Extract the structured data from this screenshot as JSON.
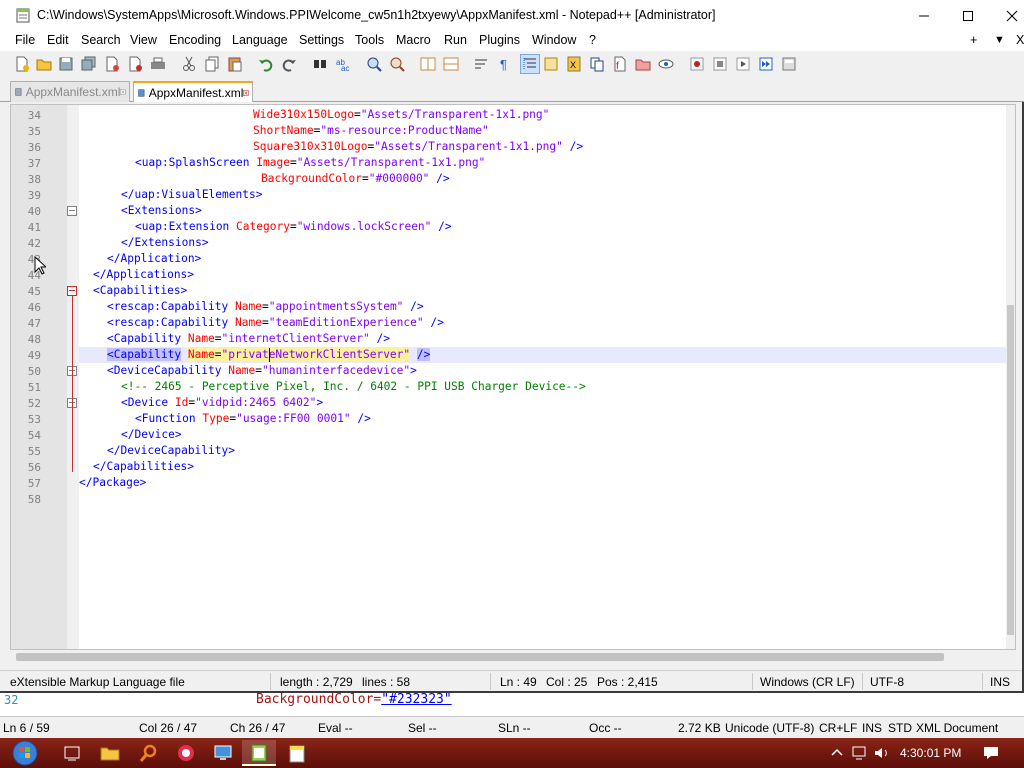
{
  "window": {
    "title": "C:\\Windows\\SystemApps\\Microsoft.Windows.PPIWelcome_cw5n1h2txyewy\\AppxManifest.xml - Notepad++ [Administrator]"
  },
  "menu": {
    "items": [
      "File",
      "Edit",
      "Search",
      "View",
      "Encoding",
      "Language",
      "Settings",
      "Tools",
      "Macro",
      "Run",
      "Plugins",
      "Window",
      "?"
    ],
    "right": [
      "+",
      "▼",
      "X"
    ]
  },
  "tabs": [
    {
      "label": "AppxManifest.xml",
      "active": false
    },
    {
      "label": "AppxManifest.xml",
      "active": true
    }
  ],
  "editor": {
    "current_line": 49,
    "lines": [
      {
        "n": "34",
        "html": "<span class=\"a\">Wide310x150Logo</span><span class=\"b\">=</span><span class=\"v\">\"Assets/Transparent-1x1.png\"</span>"
      },
      {
        "n": "35",
        "html": "<span class=\"a\">ShortName</span><span class=\"b\">=</span><span class=\"v\">\"ms-resource:ProductName\"</span>"
      },
      {
        "n": "36",
        "html": "<span class=\"a\">Square310x310Logo</span><span class=\"b\">=</span><span class=\"v\">\"Assets/Transparent-1x1.png\"</span> <span class=\"t\">/&gt;</span>"
      },
      {
        "n": "37",
        "html": "<span class=\"t\">&lt;uap:SplashScreen</span> <span class=\"a\">Image</span><span class=\"b\">=</span><span class=\"v\">\"Assets/Transparent-1x1.png\"</span>"
      },
      {
        "n": "38",
        "html": "<span class=\"a\">BackgroundColor</span><span class=\"b\">=</span><span class=\"v\">\"#000000\"</span> <span class=\"t\">/&gt;</span>"
      },
      {
        "n": "39",
        "html": "<span class=\"t\">&lt;/uap:VisualElements&gt;</span>"
      },
      {
        "n": "40",
        "html": "<span class=\"t\">&lt;Extensions&gt;</span>"
      },
      {
        "n": "41",
        "html": "<span class=\"t\">&lt;uap:Extension</span> <span class=\"a\">Category</span><span class=\"b\">=</span><span class=\"v\">\"windows.lockScreen\"</span> <span class=\"t\">/&gt;</span>"
      },
      {
        "n": "42",
        "html": "<span class=\"t\">&lt;/Extensions&gt;</span>"
      },
      {
        "n": "43",
        "html": "<span class=\"t\">&lt;/Application&gt;</span>"
      },
      {
        "n": "44",
        "html": "<span class=\"t\">&lt;/Applications&gt;</span>"
      },
      {
        "n": "45",
        "html": "<span class=\"t\">&lt;Capabilities&gt;</span>"
      },
      {
        "n": "46",
        "html": "<span class=\"t\">&lt;rescap:Capability</span> <span class=\"a\">Name</span><span class=\"b\">=</span><span class=\"v\">\"appointmentsSystem\"</span> <span class=\"t\">/&gt;</span>"
      },
      {
        "n": "47",
        "html": "<span class=\"t\">&lt;rescap:Capability</span> <span class=\"a\">Name</span><span class=\"b\">=</span><span class=\"v\">\"teamEditionExperience\"</span> <span class=\"t\">/&gt;</span>"
      },
      {
        "n": "48",
        "html": "<span class=\"t\">&lt;Capability</span> <span class=\"a\">Name</span><span class=\"b\">=</span><span class=\"v\">\"internetClientServer\"</span> <span class=\"t\">/&gt;</span>"
      },
      {
        "n": "49",
        "html": "<span class=\"hl-tag\">&lt;Capability</span> <span class=\"a hl-attr\">Name</span><span class=\"b hl-attr\">=</span><span class=\"v hl-attr\">\"privateNetworkClientServer\"</span> <span class=\"hl-tag\">/&gt;</span>"
      },
      {
        "n": "50",
        "html": "<span class=\"t\">&lt;DeviceCapability</span> <span class=\"a\">Name</span><span class=\"b\">=</span><span class=\"v\">\"humaninterfacedevice\"</span><span class=\"t\">&gt;</span>"
      },
      {
        "n": "51",
        "html": "<span class=\"c\">&lt;!-- 2465 - Perceptive Pixel, Inc. / 6402 - PPI USB Charger Device--&gt;</span>"
      },
      {
        "n": "52",
        "html": "<span class=\"t\">&lt;Device</span> <span class=\"a\">Id</span><span class=\"b\">=</span><span class=\"v\">\"vidpid:2465 6402\"</span><span class=\"t\">&gt;</span>"
      },
      {
        "n": "53",
        "html": "<span class=\"t\">&lt;Function</span> <span class=\"a\">Type</span><span class=\"b\">=</span><span class=\"v\">\"usage:FF00 0001\"</span> <span class=\"t\">/&gt;</span>"
      },
      {
        "n": "54",
        "html": "<span class=\"t\">&lt;/Device&gt;</span>"
      },
      {
        "n": "55",
        "html": "<span class=\"t\">&lt;/DeviceCapability&gt;</span>"
      },
      {
        "n": "56",
        "html": "<span class=\"t\">&lt;/Capabilities&gt;</span>"
      },
      {
        "n": "57",
        "html": "<span class=\"t\">&lt;/Package&gt;</span>"
      },
      {
        "n": "58",
        "html": ""
      }
    ]
  },
  "statusbar": {
    "filetype": "eXtensible Markup Language file",
    "length": "length : 2,729",
    "lines": "lines : 58",
    "ln": "Ln : 49",
    "col": "Col : 25",
    "pos": "Pos : 2,415",
    "eol": "Windows (CR LF)",
    "encoding": "UTF-8",
    "mode": "INS"
  },
  "back_window": {
    "line_number": "32",
    "code_attr": "BackgroundColor=",
    "code_value": "\"#232323\"",
    "status": {
      "ln": "Ln  6 / 59",
      "col": "Col  26 / 47",
      "ch": "Ch  26 / 47",
      "eval": "Eval  --",
      "sel": "Sel  --",
      "sln": "SLn  --",
      "occ": "Occ  --",
      "size": "2.72 KB",
      "encoding": "Unicode (UTF-8)",
      "eol": "CR+LF",
      "ins": "INS",
      "std": "STD",
      "doctype": "XML Document"
    }
  },
  "taskbar": {
    "clock": "4:30:01 PM"
  },
  "colors": {
    "tag": "#0000ff",
    "attribute": "#ff0000",
    "value": "#8000ff",
    "comment": "#008000",
    "taskbar": "#7a1810"
  }
}
